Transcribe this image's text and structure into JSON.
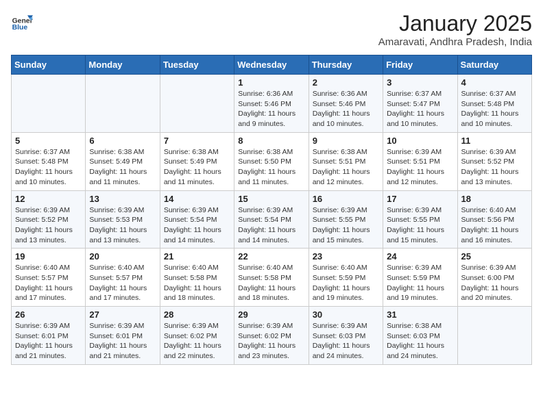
{
  "header": {
    "logo_general": "General",
    "logo_blue": "Blue",
    "title": "January 2025",
    "subtitle": "Amaravati, Andhra Pradesh, India"
  },
  "days_of_week": [
    "Sunday",
    "Monday",
    "Tuesday",
    "Wednesday",
    "Thursday",
    "Friday",
    "Saturday"
  ],
  "weeks": [
    [
      {
        "day": "",
        "info": ""
      },
      {
        "day": "",
        "info": ""
      },
      {
        "day": "",
        "info": ""
      },
      {
        "day": "1",
        "info": "Sunrise: 6:36 AM\nSunset: 5:46 PM\nDaylight: 11 hours and 9 minutes."
      },
      {
        "day": "2",
        "info": "Sunrise: 6:36 AM\nSunset: 5:46 PM\nDaylight: 11 hours and 10 minutes."
      },
      {
        "day": "3",
        "info": "Sunrise: 6:37 AM\nSunset: 5:47 PM\nDaylight: 11 hours and 10 minutes."
      },
      {
        "day": "4",
        "info": "Sunrise: 6:37 AM\nSunset: 5:48 PM\nDaylight: 11 hours and 10 minutes."
      }
    ],
    [
      {
        "day": "5",
        "info": "Sunrise: 6:37 AM\nSunset: 5:48 PM\nDaylight: 11 hours and 10 minutes."
      },
      {
        "day": "6",
        "info": "Sunrise: 6:38 AM\nSunset: 5:49 PM\nDaylight: 11 hours and 11 minutes."
      },
      {
        "day": "7",
        "info": "Sunrise: 6:38 AM\nSunset: 5:49 PM\nDaylight: 11 hours and 11 minutes."
      },
      {
        "day": "8",
        "info": "Sunrise: 6:38 AM\nSunset: 5:50 PM\nDaylight: 11 hours and 11 minutes."
      },
      {
        "day": "9",
        "info": "Sunrise: 6:38 AM\nSunset: 5:51 PM\nDaylight: 11 hours and 12 minutes."
      },
      {
        "day": "10",
        "info": "Sunrise: 6:39 AM\nSunset: 5:51 PM\nDaylight: 11 hours and 12 minutes."
      },
      {
        "day": "11",
        "info": "Sunrise: 6:39 AM\nSunset: 5:52 PM\nDaylight: 11 hours and 13 minutes."
      }
    ],
    [
      {
        "day": "12",
        "info": "Sunrise: 6:39 AM\nSunset: 5:52 PM\nDaylight: 11 hours and 13 minutes."
      },
      {
        "day": "13",
        "info": "Sunrise: 6:39 AM\nSunset: 5:53 PM\nDaylight: 11 hours and 13 minutes."
      },
      {
        "day": "14",
        "info": "Sunrise: 6:39 AM\nSunset: 5:54 PM\nDaylight: 11 hours and 14 minutes."
      },
      {
        "day": "15",
        "info": "Sunrise: 6:39 AM\nSunset: 5:54 PM\nDaylight: 11 hours and 14 minutes."
      },
      {
        "day": "16",
        "info": "Sunrise: 6:39 AM\nSunset: 5:55 PM\nDaylight: 11 hours and 15 minutes."
      },
      {
        "day": "17",
        "info": "Sunrise: 6:39 AM\nSunset: 5:55 PM\nDaylight: 11 hours and 15 minutes."
      },
      {
        "day": "18",
        "info": "Sunrise: 6:40 AM\nSunset: 5:56 PM\nDaylight: 11 hours and 16 minutes."
      }
    ],
    [
      {
        "day": "19",
        "info": "Sunrise: 6:40 AM\nSunset: 5:57 PM\nDaylight: 11 hours and 17 minutes."
      },
      {
        "day": "20",
        "info": "Sunrise: 6:40 AM\nSunset: 5:57 PM\nDaylight: 11 hours and 17 minutes."
      },
      {
        "day": "21",
        "info": "Sunrise: 6:40 AM\nSunset: 5:58 PM\nDaylight: 11 hours and 18 minutes."
      },
      {
        "day": "22",
        "info": "Sunrise: 6:40 AM\nSunset: 5:58 PM\nDaylight: 11 hours and 18 minutes."
      },
      {
        "day": "23",
        "info": "Sunrise: 6:40 AM\nSunset: 5:59 PM\nDaylight: 11 hours and 19 minutes."
      },
      {
        "day": "24",
        "info": "Sunrise: 6:39 AM\nSunset: 5:59 PM\nDaylight: 11 hours and 19 minutes."
      },
      {
        "day": "25",
        "info": "Sunrise: 6:39 AM\nSunset: 6:00 PM\nDaylight: 11 hours and 20 minutes."
      }
    ],
    [
      {
        "day": "26",
        "info": "Sunrise: 6:39 AM\nSunset: 6:01 PM\nDaylight: 11 hours and 21 minutes."
      },
      {
        "day": "27",
        "info": "Sunrise: 6:39 AM\nSunset: 6:01 PM\nDaylight: 11 hours and 21 minutes."
      },
      {
        "day": "28",
        "info": "Sunrise: 6:39 AM\nSunset: 6:02 PM\nDaylight: 11 hours and 22 minutes."
      },
      {
        "day": "29",
        "info": "Sunrise: 6:39 AM\nSunset: 6:02 PM\nDaylight: 11 hours and 23 minutes."
      },
      {
        "day": "30",
        "info": "Sunrise: 6:39 AM\nSunset: 6:03 PM\nDaylight: 11 hours and 24 minutes."
      },
      {
        "day": "31",
        "info": "Sunrise: 6:38 AM\nSunset: 6:03 PM\nDaylight: 11 hours and 24 minutes."
      },
      {
        "day": "",
        "info": ""
      }
    ]
  ]
}
